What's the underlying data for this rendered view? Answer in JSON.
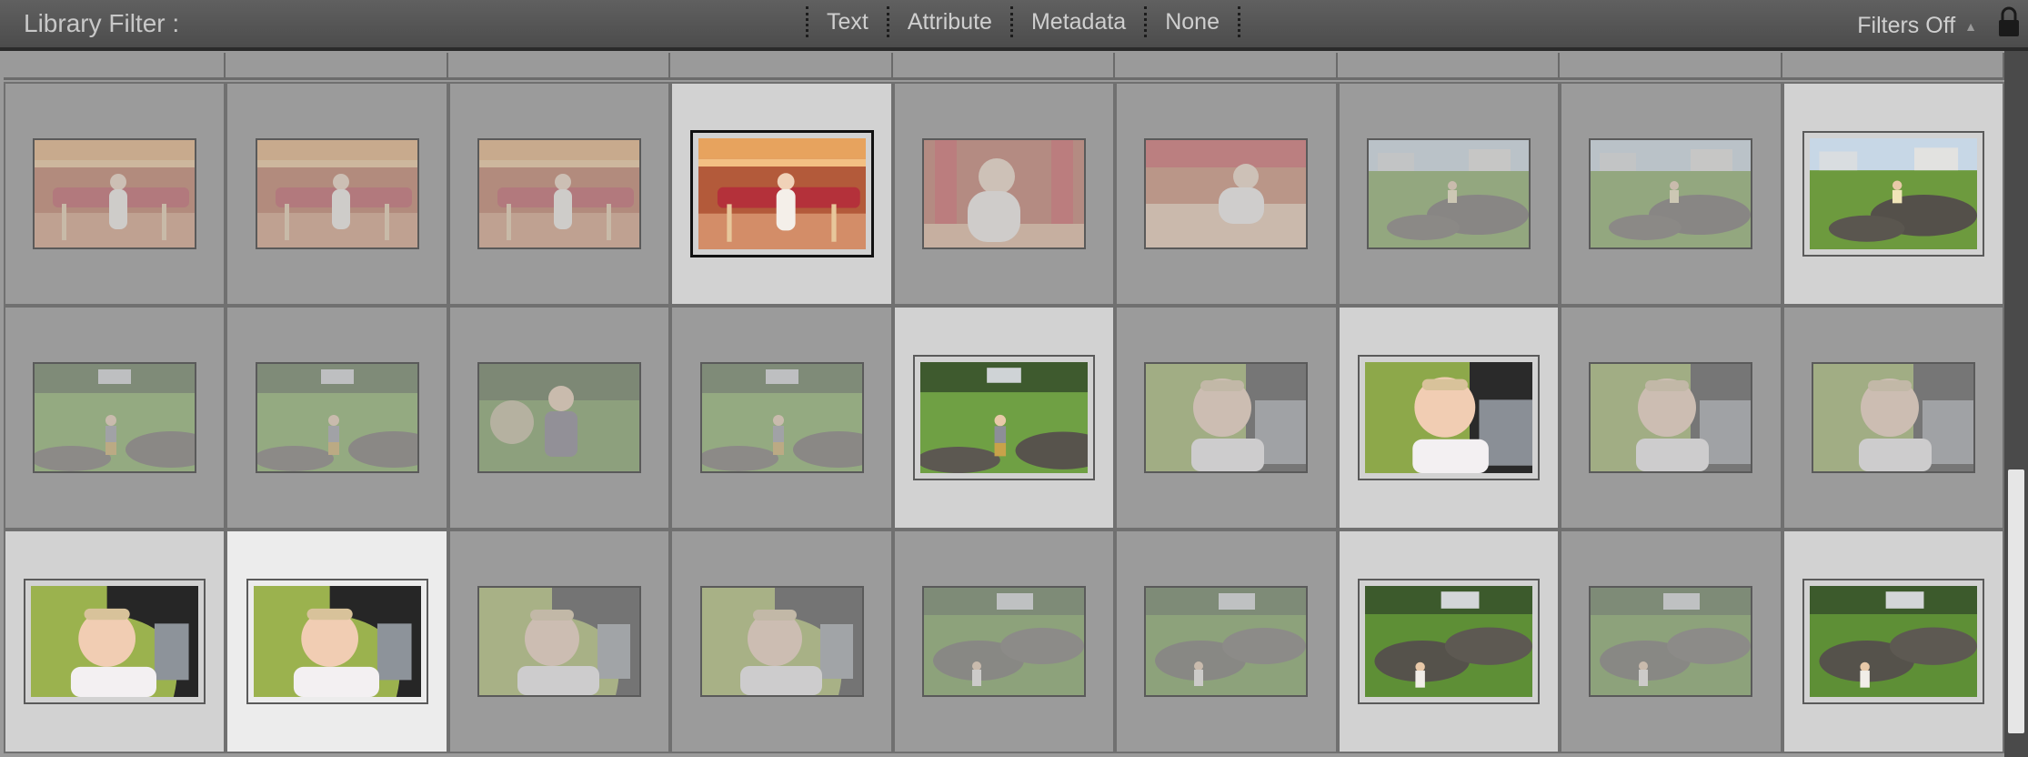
{
  "filter_bar": {
    "title": "Library Filter :",
    "tabs": [
      "Text",
      "Attribute",
      "Metadata",
      "None"
    ],
    "filters_off": "Filters Off",
    "lock_icon": "lock-icon"
  },
  "thumbnails": [
    {
      "scene": "table",
      "selected": false
    },
    {
      "scene": "table",
      "selected": false
    },
    {
      "scene": "table",
      "selected": false
    },
    {
      "scene": "table",
      "selected": true,
      "active": true
    },
    {
      "scene": "table-close",
      "selected": false
    },
    {
      "scene": "table-crawl",
      "selected": false
    },
    {
      "scene": "park-rock",
      "selected": false
    },
    {
      "scene": "park-rock",
      "selected": false
    },
    {
      "scene": "park-rock",
      "selected": true
    },
    {
      "scene": "park-far",
      "selected": false
    },
    {
      "scene": "park-far",
      "selected": false
    },
    {
      "scene": "park-near",
      "selected": false
    },
    {
      "scene": "park-far",
      "selected": false
    },
    {
      "scene": "park-far",
      "selected": true
    },
    {
      "scene": "stroller-side",
      "selected": false
    },
    {
      "scene": "stroller-side",
      "selected": true
    },
    {
      "scene": "stroller-side",
      "selected": false
    },
    {
      "scene": "stroller-side",
      "selected": false
    },
    {
      "scene": "stroller-front",
      "selected": true
    },
    {
      "scene": "stroller-front",
      "selected": true,
      "highlight": true
    },
    {
      "scene": "stroller-front",
      "selected": false
    },
    {
      "scene": "stroller-front",
      "selected": false
    },
    {
      "scene": "rocks",
      "selected": false
    },
    {
      "scene": "rocks",
      "selected": false
    },
    {
      "scene": "rocks",
      "selected": true
    },
    {
      "scene": "rocks",
      "selected": false
    },
    {
      "scene": "rocks",
      "selected": true
    }
  ]
}
